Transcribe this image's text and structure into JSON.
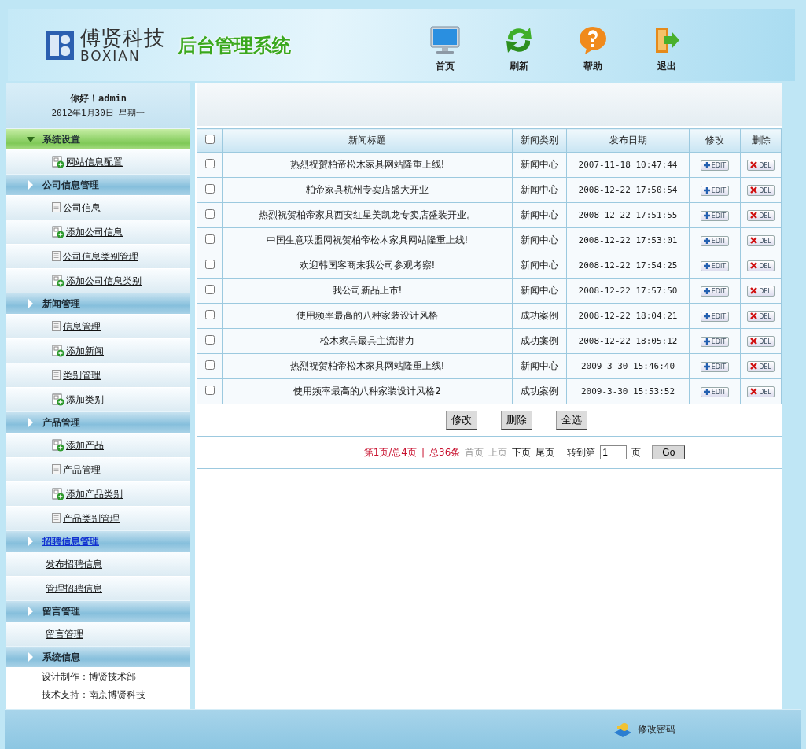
{
  "header": {
    "logo_cn": "傅贤科技",
    "logo_en": "BOXIAN",
    "system_title": "后台管理系统",
    "nav": [
      {
        "kind": "home",
        "label": "首页"
      },
      {
        "kind": "refresh",
        "label": "刷新"
      },
      {
        "kind": "help",
        "label": "帮助"
      },
      {
        "kind": "exit",
        "label": "退出"
      }
    ]
  },
  "sidebar": {
    "greeting": "你好！admin",
    "date": "2012年1月30日 星期一",
    "groups": [
      {
        "label": "系统设置",
        "expanded": true,
        "highlighted": false,
        "items": [
          {
            "label": "网站信息配置",
            "kind": "add"
          }
        ]
      },
      {
        "label": "公司信息管理",
        "expanded": false,
        "highlighted": false,
        "items": [
          {
            "label": "公司信息",
            "kind": "doc"
          },
          {
            "label": "添加公司信息",
            "kind": "add"
          },
          {
            "label": "公司信息类别管理",
            "kind": "doc"
          },
          {
            "label": "添加公司信息类别",
            "kind": "add"
          }
        ]
      },
      {
        "label": "新闻管理",
        "expanded": false,
        "highlighted": false,
        "items": [
          {
            "label": "信息管理",
            "kind": "doc"
          },
          {
            "label": "添加新闻",
            "kind": "add"
          },
          {
            "label": "类别管理",
            "kind": "doc"
          },
          {
            "label": "添加类别",
            "kind": "add"
          }
        ]
      },
      {
        "label": "产品管理",
        "expanded": false,
        "highlighted": false,
        "items": [
          {
            "label": "添加产品",
            "kind": "add"
          },
          {
            "label": "产品管理",
            "kind": "doc"
          },
          {
            "label": "添加产品类别",
            "kind": "add"
          },
          {
            "label": "产品类别管理",
            "kind": "doc"
          }
        ]
      },
      {
        "label": "招聘信息管理",
        "expanded": false,
        "highlighted": true,
        "items": [
          {
            "label": "发布招聘信息",
            "kind": "plain"
          },
          {
            "label": "管理招聘信息",
            "kind": "plain"
          }
        ]
      },
      {
        "label": "留言管理",
        "expanded": false,
        "highlighted": false,
        "items": [
          {
            "label": "留言管理",
            "kind": "plain"
          }
        ]
      },
      {
        "label": "系统信息",
        "expanded": false,
        "highlighted": false,
        "lines": [
          "设计制作：博贤技术部",
          "技术支持：南京博贤科技"
        ]
      }
    ]
  },
  "table": {
    "select_all_checked": false,
    "columns": [
      "新闻标题",
      "新闻类别",
      "发布日期",
      "修改",
      "删除"
    ],
    "rows": [
      {
        "checked": false,
        "title": "热烈祝贺柏帝松木家具网站隆重上线!",
        "category": "新闻中心",
        "date": "2007-11-18 10:47:44",
        "edit": "EDIT",
        "delete": "DEL"
      },
      {
        "checked": false,
        "title": "柏帝家具杭州专卖店盛大开业",
        "category": "新闻中心",
        "date": "2008-12-22 17:50:54",
        "edit": "EDIT",
        "delete": "DEL"
      },
      {
        "checked": false,
        "title": "热烈祝贺柏帝家具西安红星美凯龙专卖店盛装开业。",
        "category": "新闻中心",
        "date": "2008-12-22 17:51:55",
        "edit": "EDIT",
        "delete": "DEL"
      },
      {
        "checked": false,
        "title": "中国生意联盟网祝贺柏帝松木家具网站隆重上线!",
        "category": "新闻中心",
        "date": "2008-12-22 17:53:01",
        "edit": "EDIT",
        "delete": "DEL"
      },
      {
        "checked": false,
        "title": "欢迎韩国客商来我公司参观考察!",
        "category": "新闻中心",
        "date": "2008-12-22 17:54:25",
        "edit": "EDIT",
        "delete": "DEL"
      },
      {
        "checked": false,
        "title": "我公司新品上市!",
        "category": "新闻中心",
        "date": "2008-12-22 17:57:50",
        "edit": "EDIT",
        "delete": "DEL"
      },
      {
        "checked": false,
        "title": "使用频率最高的八种家装设计风格",
        "category": "成功案例",
        "date": "2008-12-22 18:04:21",
        "edit": "EDIT",
        "delete": "DEL"
      },
      {
        "checked": false,
        "title": "松木家具最具主流潜力",
        "category": "成功案例",
        "date": "2008-12-22 18:05:12",
        "edit": "EDIT",
        "delete": "DEL"
      },
      {
        "checked": false,
        "title": "热烈祝贺柏帝松木家具网站隆重上线!",
        "category": "新闻中心",
        "date": "2009-3-30 15:46:40",
        "edit": "EDIT",
        "delete": "DEL"
      },
      {
        "checked": false,
        "title": "使用频率最高的八种家装设计风格2",
        "category": "成功案例",
        "date": "2009-3-30 15:53:52",
        "edit": "EDIT",
        "delete": "DEL"
      }
    ],
    "actions": [
      "修改",
      "删除",
      "全选"
    ]
  },
  "pagination": {
    "summary": "第1页/总4页",
    "separator": "|",
    "total": "总36条",
    "links": [
      {
        "label": "首页",
        "disabled": true
      },
      {
        "label": "上页",
        "disabled": true
      },
      {
        "label": "下页",
        "disabled": false
      },
      {
        "label": "尾页",
        "disabled": false
      }
    ],
    "goto_label": "转到第",
    "page_value": "1",
    "page_suffix": "页",
    "go_button": "Go"
  },
  "footer": {
    "change_password": "修改密码"
  }
}
